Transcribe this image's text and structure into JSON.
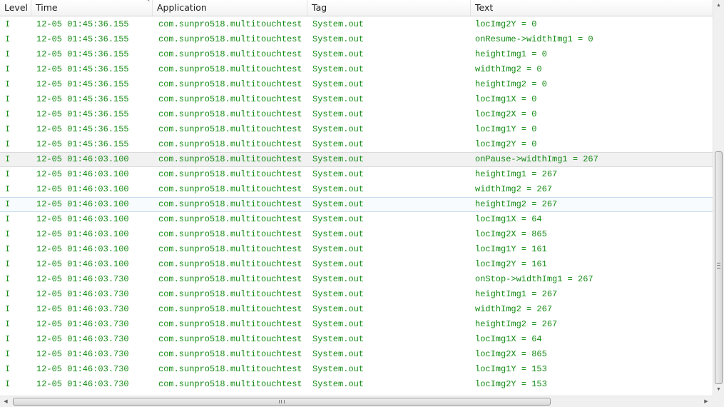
{
  "columns": {
    "level": "Level",
    "time": "Time",
    "application": "Application",
    "tag": "Tag",
    "text": "Text",
    "sort_indicator": "ˆ"
  },
  "colors": {
    "log_text": "#138a13",
    "header_text": "#1e1e1e"
  },
  "icons": {
    "vscroll_up": "triangle-up-icon",
    "vscroll_down": "triangle-down-icon",
    "hscroll_left": "triangle-left-icon",
    "hscroll_right": "triangle-right-icon"
  },
  "rows": [
    {
      "level": "I",
      "time": "12-05 01:45:36.155",
      "application": "com.sunpro518.multitouchtest",
      "tag": "System.out",
      "text": "locImg2Y = 0"
    },
    {
      "level": "I",
      "time": "12-05 01:45:36.155",
      "application": "com.sunpro518.multitouchtest",
      "tag": "System.out",
      "text": "onResume->widthImg1 = 0"
    },
    {
      "level": "I",
      "time": "12-05 01:45:36.155",
      "application": "com.sunpro518.multitouchtest",
      "tag": "System.out",
      "text": "heightImg1 = 0"
    },
    {
      "level": "I",
      "time": "12-05 01:45:36.155",
      "application": "com.sunpro518.multitouchtest",
      "tag": "System.out",
      "text": "widthImg2 = 0"
    },
    {
      "level": "I",
      "time": "12-05 01:45:36.155",
      "application": "com.sunpro518.multitouchtest",
      "tag": "System.out",
      "text": "heightImg2 = 0"
    },
    {
      "level": "I",
      "time": "12-05 01:45:36.155",
      "application": "com.sunpro518.multitouchtest",
      "tag": "System.out",
      "text": "locImg1X = 0"
    },
    {
      "level": "I",
      "time": "12-05 01:45:36.155",
      "application": "com.sunpro518.multitouchtest",
      "tag": "System.out",
      "text": "locImg2X = 0"
    },
    {
      "level": "I",
      "time": "12-05 01:45:36.155",
      "application": "com.sunpro518.multitouchtest",
      "tag": "System.out",
      "text": "locImg1Y = 0"
    },
    {
      "level": "I",
      "time": "12-05 01:45:36.155",
      "application": "com.sunpro518.multitouchtest",
      "tag": "System.out",
      "text": "locImg2Y = 0"
    },
    {
      "level": "I",
      "time": "12-05 01:46:03.100",
      "application": "com.sunpro518.multitouchtest",
      "tag": "System.out",
      "text": "onPause->widthImg1 = 267",
      "state": "selected"
    },
    {
      "level": "I",
      "time": "12-05 01:46:03.100",
      "application": "com.sunpro518.multitouchtest",
      "tag": "System.out",
      "text": "heightImg1 = 267"
    },
    {
      "level": "I",
      "time": "12-05 01:46:03.100",
      "application": "com.sunpro518.multitouchtest",
      "tag": "System.out",
      "text": "widthImg2 = 267"
    },
    {
      "level": "I",
      "time": "12-05 01:46:03.100",
      "application": "com.sunpro518.multitouchtest",
      "tag": "System.out",
      "text": "heightImg2 = 267",
      "state": "hover"
    },
    {
      "level": "I",
      "time": "12-05 01:46:03.100",
      "application": "com.sunpro518.multitouchtest",
      "tag": "System.out",
      "text": "locImg1X = 64"
    },
    {
      "level": "I",
      "time": "12-05 01:46:03.100",
      "application": "com.sunpro518.multitouchtest",
      "tag": "System.out",
      "text": "locImg2X = 865"
    },
    {
      "level": "I",
      "time": "12-05 01:46:03.100",
      "application": "com.sunpro518.multitouchtest",
      "tag": "System.out",
      "text": "locImg1Y = 161"
    },
    {
      "level": "I",
      "time": "12-05 01:46:03.100",
      "application": "com.sunpro518.multitouchtest",
      "tag": "System.out",
      "text": "locImg2Y = 161"
    },
    {
      "level": "I",
      "time": "12-05 01:46:03.730",
      "application": "com.sunpro518.multitouchtest",
      "tag": "System.out",
      "text": "onStop->widthImg1 = 267"
    },
    {
      "level": "I",
      "time": "12-05 01:46:03.730",
      "application": "com.sunpro518.multitouchtest",
      "tag": "System.out",
      "text": "heightImg1 = 267"
    },
    {
      "level": "I",
      "time": "12-05 01:46:03.730",
      "application": "com.sunpro518.multitouchtest",
      "tag": "System.out",
      "text": "widthImg2 = 267"
    },
    {
      "level": "I",
      "time": "12-05 01:46:03.730",
      "application": "com.sunpro518.multitouchtest",
      "tag": "System.out",
      "text": "heightImg2 = 267"
    },
    {
      "level": "I",
      "time": "12-05 01:46:03.730",
      "application": "com.sunpro518.multitouchtest",
      "tag": "System.out",
      "text": "locImg1X = 64"
    },
    {
      "level": "I",
      "time": "12-05 01:46:03.730",
      "application": "com.sunpro518.multitouchtest",
      "tag": "System.out",
      "text": "locImg2X = 865"
    },
    {
      "level": "I",
      "time": "12-05 01:46:03.730",
      "application": "com.sunpro518.multitouchtest",
      "tag": "System.out",
      "text": "locImg1Y = 153"
    },
    {
      "level": "I",
      "time": "12-05 01:46:03.730",
      "application": "com.sunpro518.multitouchtest",
      "tag": "System.out",
      "text": "locImg2Y = 153"
    }
  ]
}
